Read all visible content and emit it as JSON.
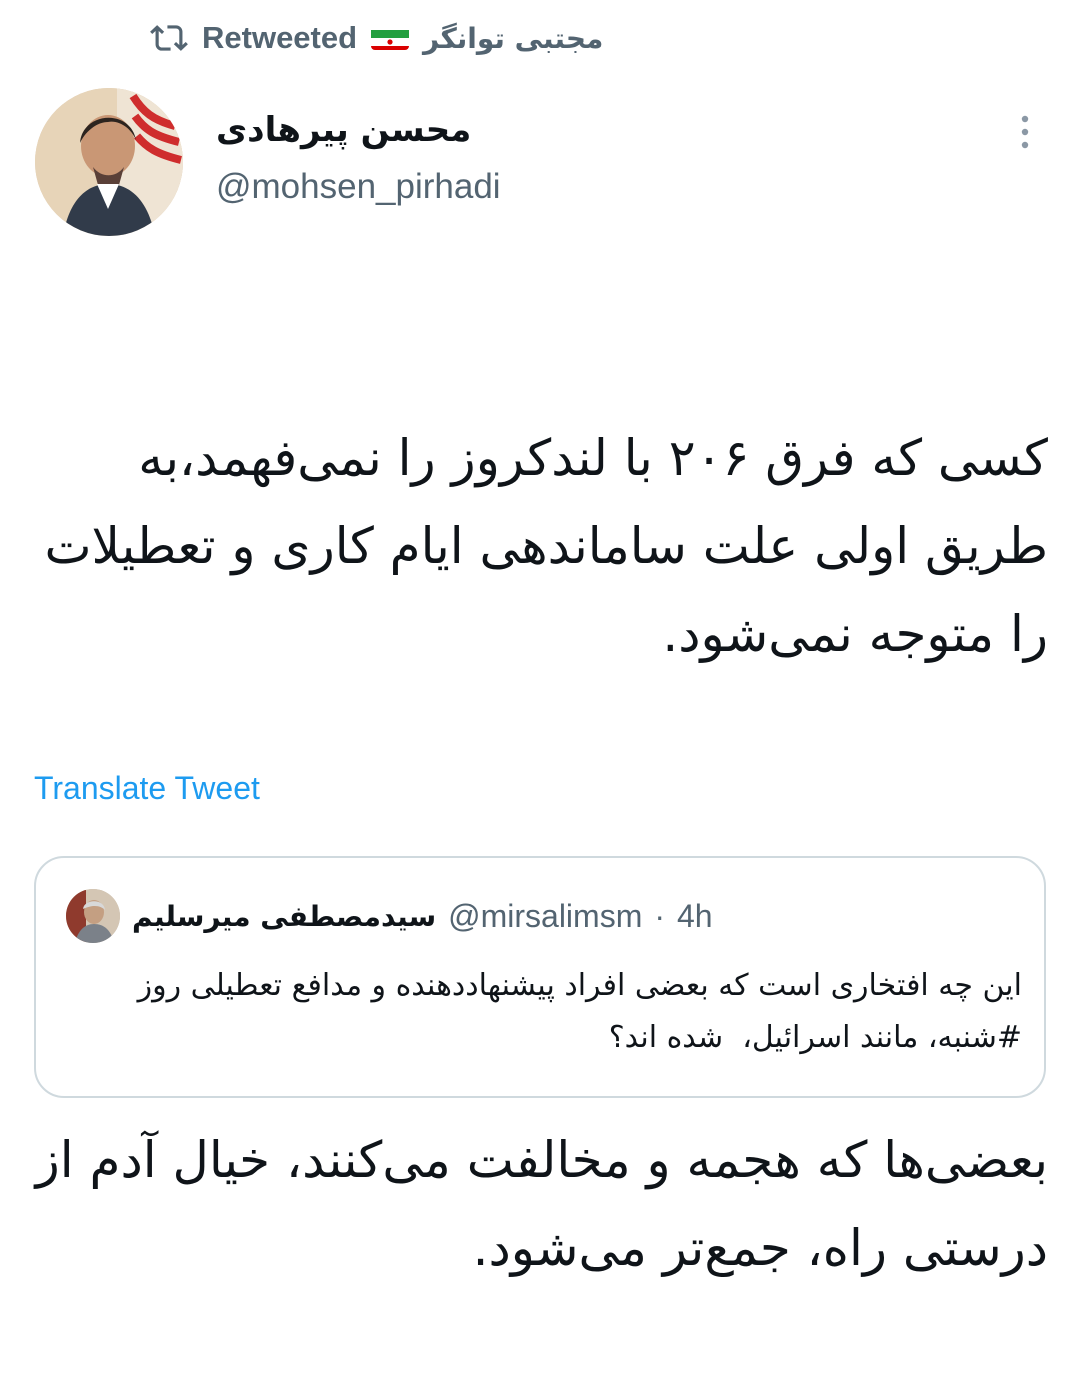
{
  "retweet": {
    "icon": "retweet-icon",
    "label": "Retweeted",
    "flag": "iran-flag-icon",
    "retweeter_name": "مجتبی توانگر"
  },
  "author": {
    "name": "محسن پیرهادی",
    "handle": "@mohsen_pirhadi"
  },
  "tweet": {
    "paragraph1": "کسی که فرق ۲۰۶ با لندکروز را نمی‌فهمد،به طریق اولی علت ساماندهی ایام کاری و تعطیلات را متوجه نمی‌شود.",
    "paragraph2": "بعضی‌ها که هجمه و مخالفت می‌کنند، خیال آدم از درستی راه، جمع‌تر می‌شود."
  },
  "translate": {
    "label": "Translate Tweet"
  },
  "quote": {
    "name": "سیدمصطفی میرسلیم",
    "handle": "@mirsalimsm",
    "dot": "·",
    "time": "4h",
    "text": "این چه افتخاری است که بعضی افراد پیشنهاددهنده و مدافع تعطیلی روز #شنبه، مانند اسرائیل،  شده اند؟"
  },
  "colors": {
    "text_primary": "#0f1419",
    "text_secondary": "#536471",
    "link": "#1d9bf0",
    "border": "#cfd9de"
  }
}
